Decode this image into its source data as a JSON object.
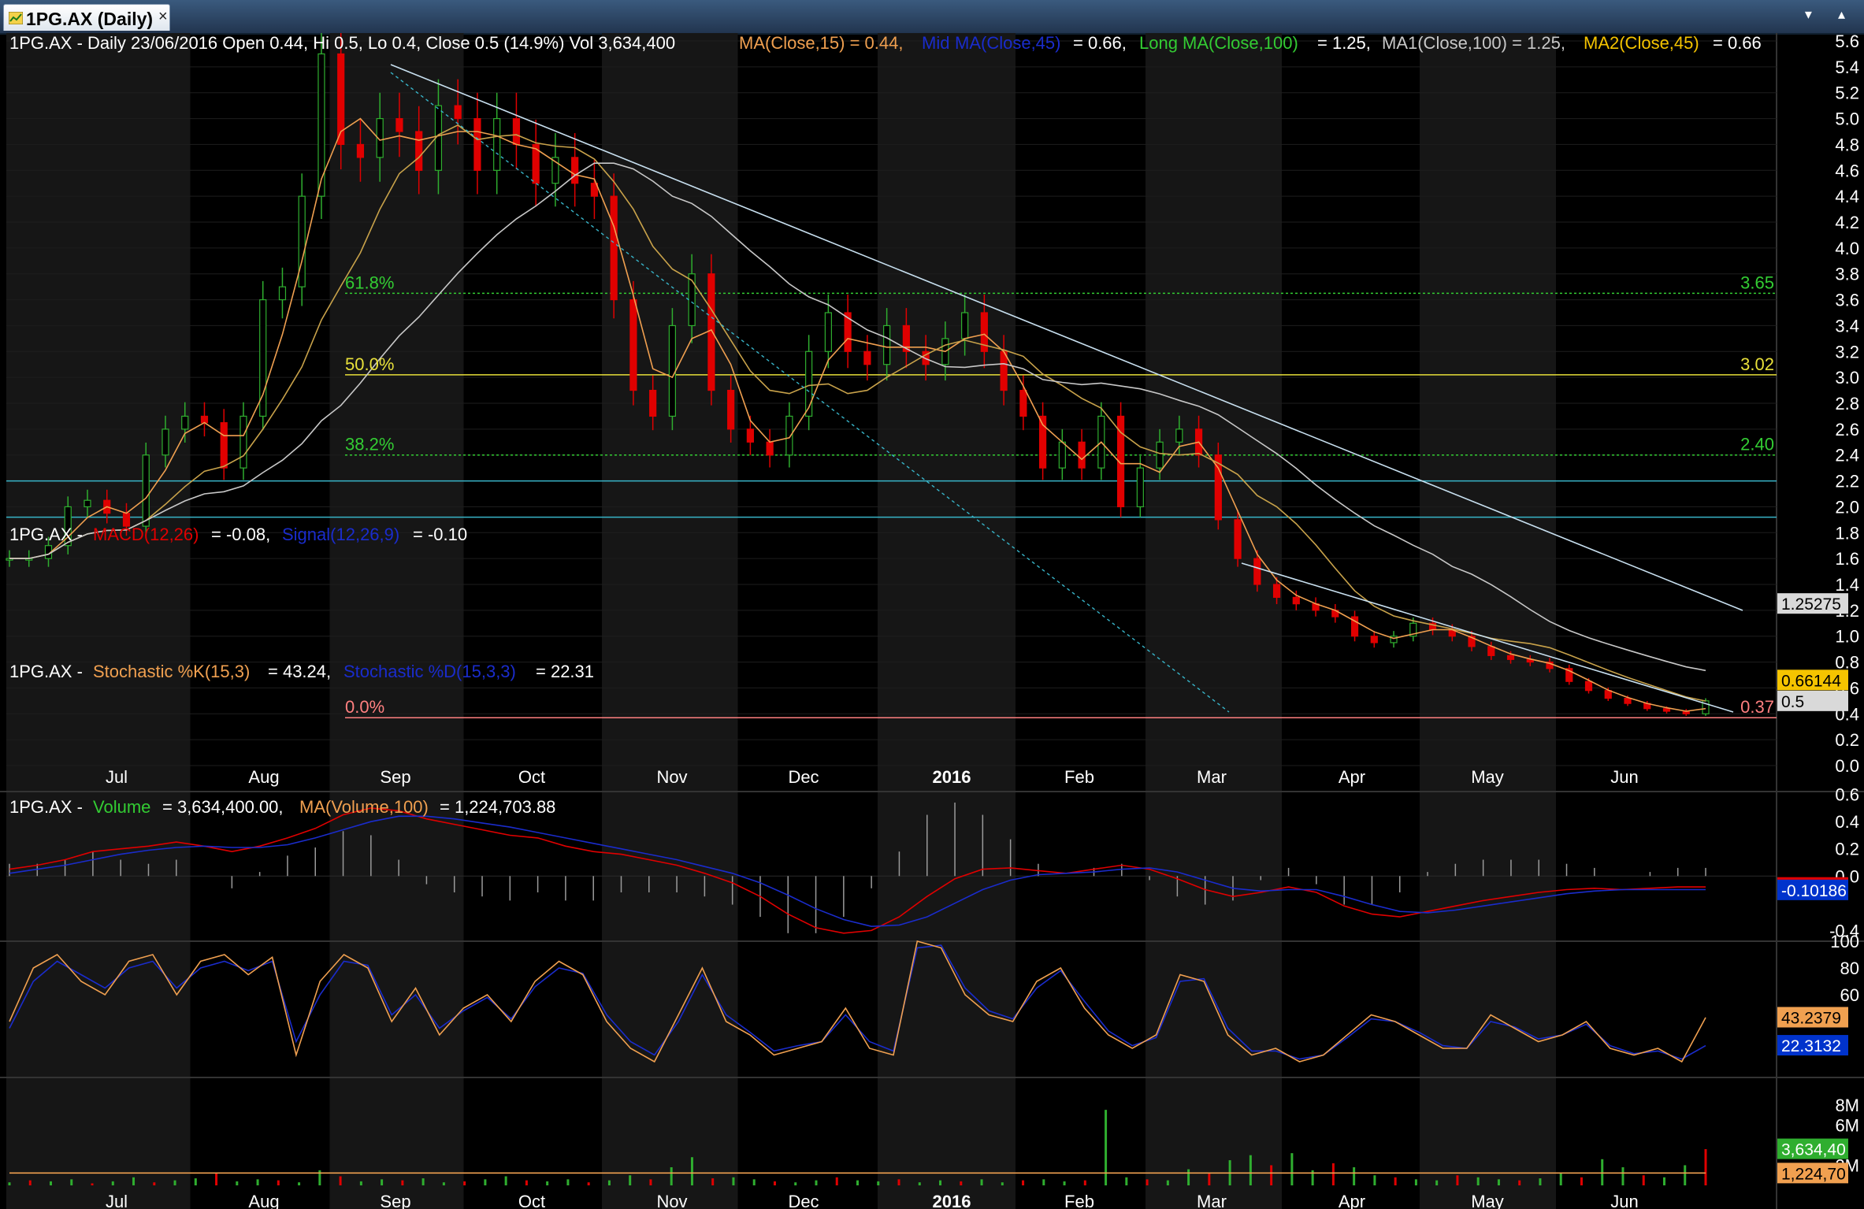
{
  "window": {
    "tab_title": "1PG.AX (Daily)",
    "close_glyph": "×",
    "controls": "▾ ▴"
  },
  "chart_data": [
    {
      "panel": "price",
      "type": "candlestick",
      "info": {
        "symbol": "1PG.AX - Daily 23/06/2016 Open 0.44, Hi 0.5, Lo 0.4, Close 0.5 (14.9%) Vol 3,634,400",
        "ma15": "MA(Close,15) = 0.44,",
        "mid_label": "Mid",
        "mid_ma": "MA(Close,45)",
        "mid_val": "= 0.66,",
        "long_ma": "Long MA(Close,100)",
        "long_val": "= 1.25,",
        "ma1": "MA1(Close,100) = 1.25,",
        "ma2": "MA2(Close,45)",
        "ma2_val": "= 0.66"
      },
      "x_labels": [
        "Jul",
        "Aug",
        "Sep",
        "Oct",
        "Nov",
        "Dec",
        "2016",
        "Feb",
        "Mar",
        "Apr",
        "May",
        "Jun"
      ],
      "y_ticks": [
        "0.0",
        "0.2",
        "0.4",
        "0.6",
        "0.8",
        "1.0",
        "1.2",
        "1.4",
        "1.6",
        "1.8",
        "2.0",
        "2.2",
        "2.4",
        "2.6",
        "2.8",
        "3.0",
        "3.2",
        "3.4",
        "3.6",
        "3.8",
        "4.0",
        "4.2",
        "4.4",
        "4.6",
        "4.8",
        "5.0",
        "5.2",
        "5.4",
        "5.6"
      ],
      "ylim": [
        0,
        5.6
      ],
      "trend": [
        1.6,
        1.6,
        1.7,
        2.0,
        2.05,
        1.95,
        1.85,
        2.4,
        2.6,
        2.7,
        2.65,
        2.3,
        2.7,
        3.6,
        3.7,
        4.4,
        5.5,
        4.8,
        4.7,
        5.0,
        4.9,
        4.6,
        5.1,
        5.0,
        4.6,
        5.0,
        4.8,
        4.5,
        4.7,
        4.5,
        4.4,
        3.6,
        2.9,
        2.7,
        3.4,
        3.8,
        2.9,
        2.6,
        2.5,
        2.4,
        2.7,
        3.2,
        3.5,
        3.2,
        3.1,
        3.4,
        3.2,
        3.1,
        3.3,
        3.5,
        3.2,
        2.9,
        2.7,
        2.3,
        2.5,
        2.3,
        2.7,
        2.0,
        2.3,
        2.5,
        2.6,
        2.4,
        1.9,
        1.6,
        1.4,
        1.3,
        1.25,
        1.2,
        1.15,
        1.0,
        0.95,
        1.0,
        1.1,
        1.05,
        1.0,
        0.92,
        0.85,
        0.82,
        0.8,
        0.75,
        0.65,
        0.58,
        0.52,
        0.48,
        0.44,
        0.42,
        0.4,
        0.5
      ],
      "ma15": "price-ma15",
      "fib_levels": [
        {
          "pct": "61.8%",
          "value": "3.65"
        },
        {
          "pct": "50.0%",
          "value": "3.02"
        },
        {
          "pct": "38.2%",
          "value": "2.40"
        },
        {
          "pct": "0.0%",
          "value": "0.37"
        }
      ],
      "markers": [
        {
          "text": "1.25275",
          "y": 1.25275,
          "bg": "#d9d9d9",
          "fg": "#000000"
        },
        {
          "text": "0.66144",
          "y": 0.66144,
          "bg": "#f5c400",
          "fg": "#000000"
        },
        {
          "text": "0.5",
          "y": 0.5,
          "bg": "#d9d9d9",
          "fg": "#000000"
        }
      ],
      "horizontal_lines": [
        2.2,
        1.92
      ],
      "colors": {
        "up": "#2fae2f",
        "down": "#e00000",
        "ma15": "#f0a050",
        "ma45": "#c8a24a",
        "ma100": "#c8c8c8",
        "fib": "#33cc33",
        "fib50": "#e8e03a",
        "fib0": "#ff8080",
        "hline": "#38b4c8"
      }
    },
    {
      "panel": "macd",
      "type": "line",
      "info": {
        "symbol": "1PG.AX -",
        "macd_label": "MACD(12,26)",
        "macd_val": "= -0.08,",
        "signal_label": "Signal(12,26,9)",
        "signal_val": "= -0.10"
      },
      "y_ticks": [
        "0.6",
        "0.4",
        "0.2",
        "0.0",
        "-0.4"
      ],
      "ylim": [
        -0.45,
        0.65
      ],
      "macd": [
        0.05,
        0.08,
        0.12,
        0.18,
        0.2,
        0.22,
        0.25,
        0.22,
        0.18,
        0.22,
        0.28,
        0.35,
        0.45,
        0.5,
        0.48,
        0.42,
        0.38,
        0.34,
        0.3,
        0.28,
        0.22,
        0.18,
        0.16,
        0.12,
        0.08,
        0.02,
        -0.05,
        -0.15,
        -0.28,
        -0.38,
        -0.42,
        -0.4,
        -0.3,
        -0.15,
        -0.02,
        0.05,
        0.06,
        0.04,
        0.02,
        0.05,
        0.08,
        0.05,
        -0.02,
        -0.1,
        -0.15,
        -0.12,
        -0.08,
        -0.12,
        -0.22,
        -0.28,
        -0.3,
        -0.26,
        -0.22,
        -0.18,
        -0.15,
        -0.12,
        -0.1,
        -0.09,
        -0.1,
        -0.09,
        -0.08,
        -0.08
      ],
      "signal": [
        0.02,
        0.05,
        0.08,
        0.12,
        0.16,
        0.19,
        0.21,
        0.22,
        0.21,
        0.21,
        0.23,
        0.28,
        0.34,
        0.4,
        0.44,
        0.44,
        0.42,
        0.39,
        0.36,
        0.32,
        0.28,
        0.24,
        0.2,
        0.16,
        0.12,
        0.07,
        0.02,
        -0.05,
        -0.14,
        -0.24,
        -0.32,
        -0.37,
        -0.36,
        -0.3,
        -0.2,
        -0.1,
        -0.03,
        0.01,
        0.02,
        0.03,
        0.05,
        0.06,
        0.03,
        -0.03,
        -0.09,
        -0.11,
        -0.1,
        -0.1,
        -0.15,
        -0.21,
        -0.26,
        -0.27,
        -0.25,
        -0.22,
        -0.19,
        -0.16,
        -0.13,
        -0.11,
        -0.1,
        -0.1,
        -0.1,
        -0.1
      ],
      "markers": [
        {
          "text": "-0.08337",
          "y": -0.08337,
          "bg": "#e00000",
          "fg": "#ffffff"
        },
        {
          "text": "-0.10186",
          "y": -0.10186,
          "bg": "#0033cc",
          "fg": "#ffffff"
        }
      ],
      "colors": {
        "macd": "#e00000",
        "signal": "#1a2ccc",
        "hist": "#9a9a9a"
      }
    },
    {
      "panel": "stochastic",
      "type": "line",
      "info": {
        "symbol": "1PG.AX -",
        "k_label": "Stochastic %K(15,3)",
        "k_val": "= 43.24,",
        "d_label": "Stochastic %D(15,3,3)",
        "d_val": "= 22.31"
      },
      "y_ticks": [
        "100",
        "80",
        "60"
      ],
      "ylim": [
        0,
        100
      ],
      "k": [
        40,
        80,
        90,
        70,
        60,
        85,
        90,
        60,
        85,
        90,
        75,
        88,
        15,
        70,
        90,
        80,
        40,
        65,
        30,
        50,
        60,
        40,
        70,
        85,
        75,
        40,
        20,
        10,
        45,
        80,
        40,
        30,
        15,
        20,
        25,
        50,
        20,
        15,
        100,
        95,
        60,
        45,
        40,
        70,
        80,
        50,
        30,
        20,
        30,
        75,
        70,
        30,
        15,
        20,
        10,
        15,
        30,
        45,
        40,
        30,
        20,
        20,
        45,
        35,
        25,
        30,
        40,
        20,
        15,
        20,
        10,
        43
      ],
      "d": [
        35,
        70,
        85,
        75,
        65,
        80,
        85,
        65,
        80,
        85,
        78,
        85,
        25,
        60,
        85,
        82,
        45,
        60,
        35,
        48,
        58,
        42,
        66,
        80,
        76,
        45,
        25,
        15,
        40,
        75,
        45,
        32,
        18,
        22,
        25,
        45,
        25,
        18,
        95,
        97,
        65,
        48,
        42,
        65,
        78,
        55,
        33,
        22,
        28,
        70,
        72,
        35,
        18,
        18,
        12,
        15,
        28,
        42,
        40,
        32,
        22,
        20,
        40,
        36,
        27,
        30,
        38,
        22,
        16,
        18,
        12,
        22
      ],
      "markers": [
        {
          "text": "43.2379",
          "y": 43.2379,
          "bg": "#f0a050",
          "fg": "#000000"
        },
        {
          "text": "22.3132",
          "y": 22.3132,
          "bg": "#0033cc",
          "fg": "#ffffff"
        }
      ],
      "colors": {
        "k": "#f0a050",
        "d": "#1a2ccc"
      }
    },
    {
      "panel": "volume",
      "type": "bar",
      "info": {
        "symbol": "1PG.AX -",
        "vol_label": "Volume",
        "vol_val": "= 3,634,400.00,",
        "ma_label": "MA(Volume,100)",
        "ma_val": "= 1,224,703.88"
      },
      "y_ticks": [
        "8M",
        "6M",
        "2M"
      ],
      "ylim": [
        0,
        9000000
      ],
      "x_labels": [
        "Jul",
        "Aug",
        "Sep",
        "Oct",
        "Nov",
        "Dec",
        "2016",
        "Feb",
        "Mar",
        "Apr",
        "May",
        "Jun"
      ],
      "volumes": [
        0.3,
        0.5,
        0.4,
        0.6,
        0.2,
        0.4,
        0.8,
        0.3,
        0.5,
        0.7,
        1.2,
        0.4,
        0.6,
        0.5,
        0.3,
        1.5,
        0.9,
        0.4,
        0.6,
        0.5,
        0.7,
        0.3,
        0.4,
        0.6,
        0.9,
        0.5,
        0.4,
        0.6,
        0.3,
        0.5,
        1.0,
        0.6,
        1.8,
        2.8,
        0.7,
        0.8,
        0.6,
        0.4,
        0.3,
        0.5,
        0.8,
        0.5,
        0.4,
        0.6,
        0.3,
        0.5,
        0.4,
        0.6,
        0.3,
        0.5,
        0.6,
        0.4,
        0.5,
        7.5,
        0.8,
        0.6,
        0.5,
        1.6,
        1.2,
        2.5,
        3.0,
        2.0,
        3.2,
        1.5,
        2.2,
        1.8,
        1.0,
        0.8,
        0.6,
        0.5,
        1.0,
        0.8,
        0.6,
        0.5,
        0.7,
        1.2,
        0.8,
        2.6,
        1.8,
        1.0,
        0.8,
        2.0,
        3.6
      ],
      "volume_colors": "mixed",
      "ma_volume": 1224703.88,
      "markers": [
        {
          "text": "3,634,40",
          "y": 3634400,
          "bg": "#2fae2f",
          "fg": "#ffffff"
        },
        {
          "text": "1,224,70",
          "y": 1224703.88,
          "bg": "#f0a050",
          "fg": "#000000"
        }
      ],
      "colors": {
        "up": "#2fae2f",
        "down": "#e00000",
        "ma": "#f0a050"
      }
    }
  ]
}
